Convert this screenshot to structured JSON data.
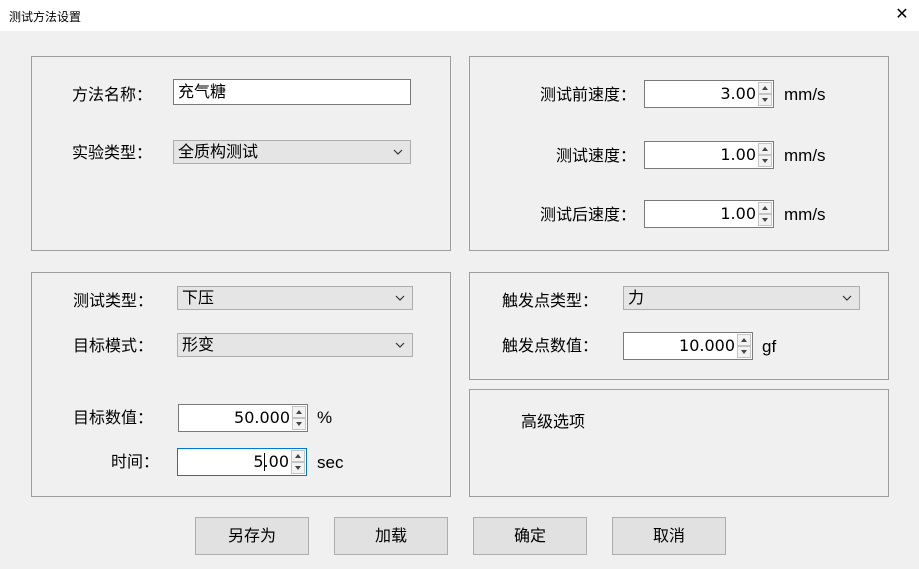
{
  "window": {
    "title": "测试方法设置"
  },
  "method": {
    "name_label": "方法名称：",
    "name_value": "充气糖",
    "type_label": "实验类型：",
    "type_value": "全质构测试"
  },
  "speeds": {
    "pre_label": "测试前速度：",
    "pre_value": "3.00",
    "test_label": "测试速度：",
    "test_value": "1.00",
    "post_label": "测试后速度：",
    "post_value": "1.00",
    "unit": "mm/s"
  },
  "test": {
    "type_label": "测试类型：",
    "type_value": "下压",
    "mode_label": "目标模式：",
    "mode_value": "形变",
    "target_label": "目标数值：",
    "target_value": "50.000",
    "target_unit": "%",
    "time_label": "时间：",
    "time_value": "5.00",
    "time_unit": "sec"
  },
  "trigger": {
    "type_label": "触发点类型：",
    "type_value": "力",
    "value_label": "触发点数值：",
    "value_value": "10.000",
    "value_unit": "gf"
  },
  "advanced": {
    "label": "高级选项"
  },
  "buttons": {
    "save_as": "另存为",
    "load": "加载",
    "ok": "确定",
    "cancel": "取消"
  },
  "icons": {
    "close": "close-icon",
    "dropdown": "chevron-down-icon",
    "spin_up": "arrow-up-icon",
    "spin_down": "arrow-down-icon"
  }
}
